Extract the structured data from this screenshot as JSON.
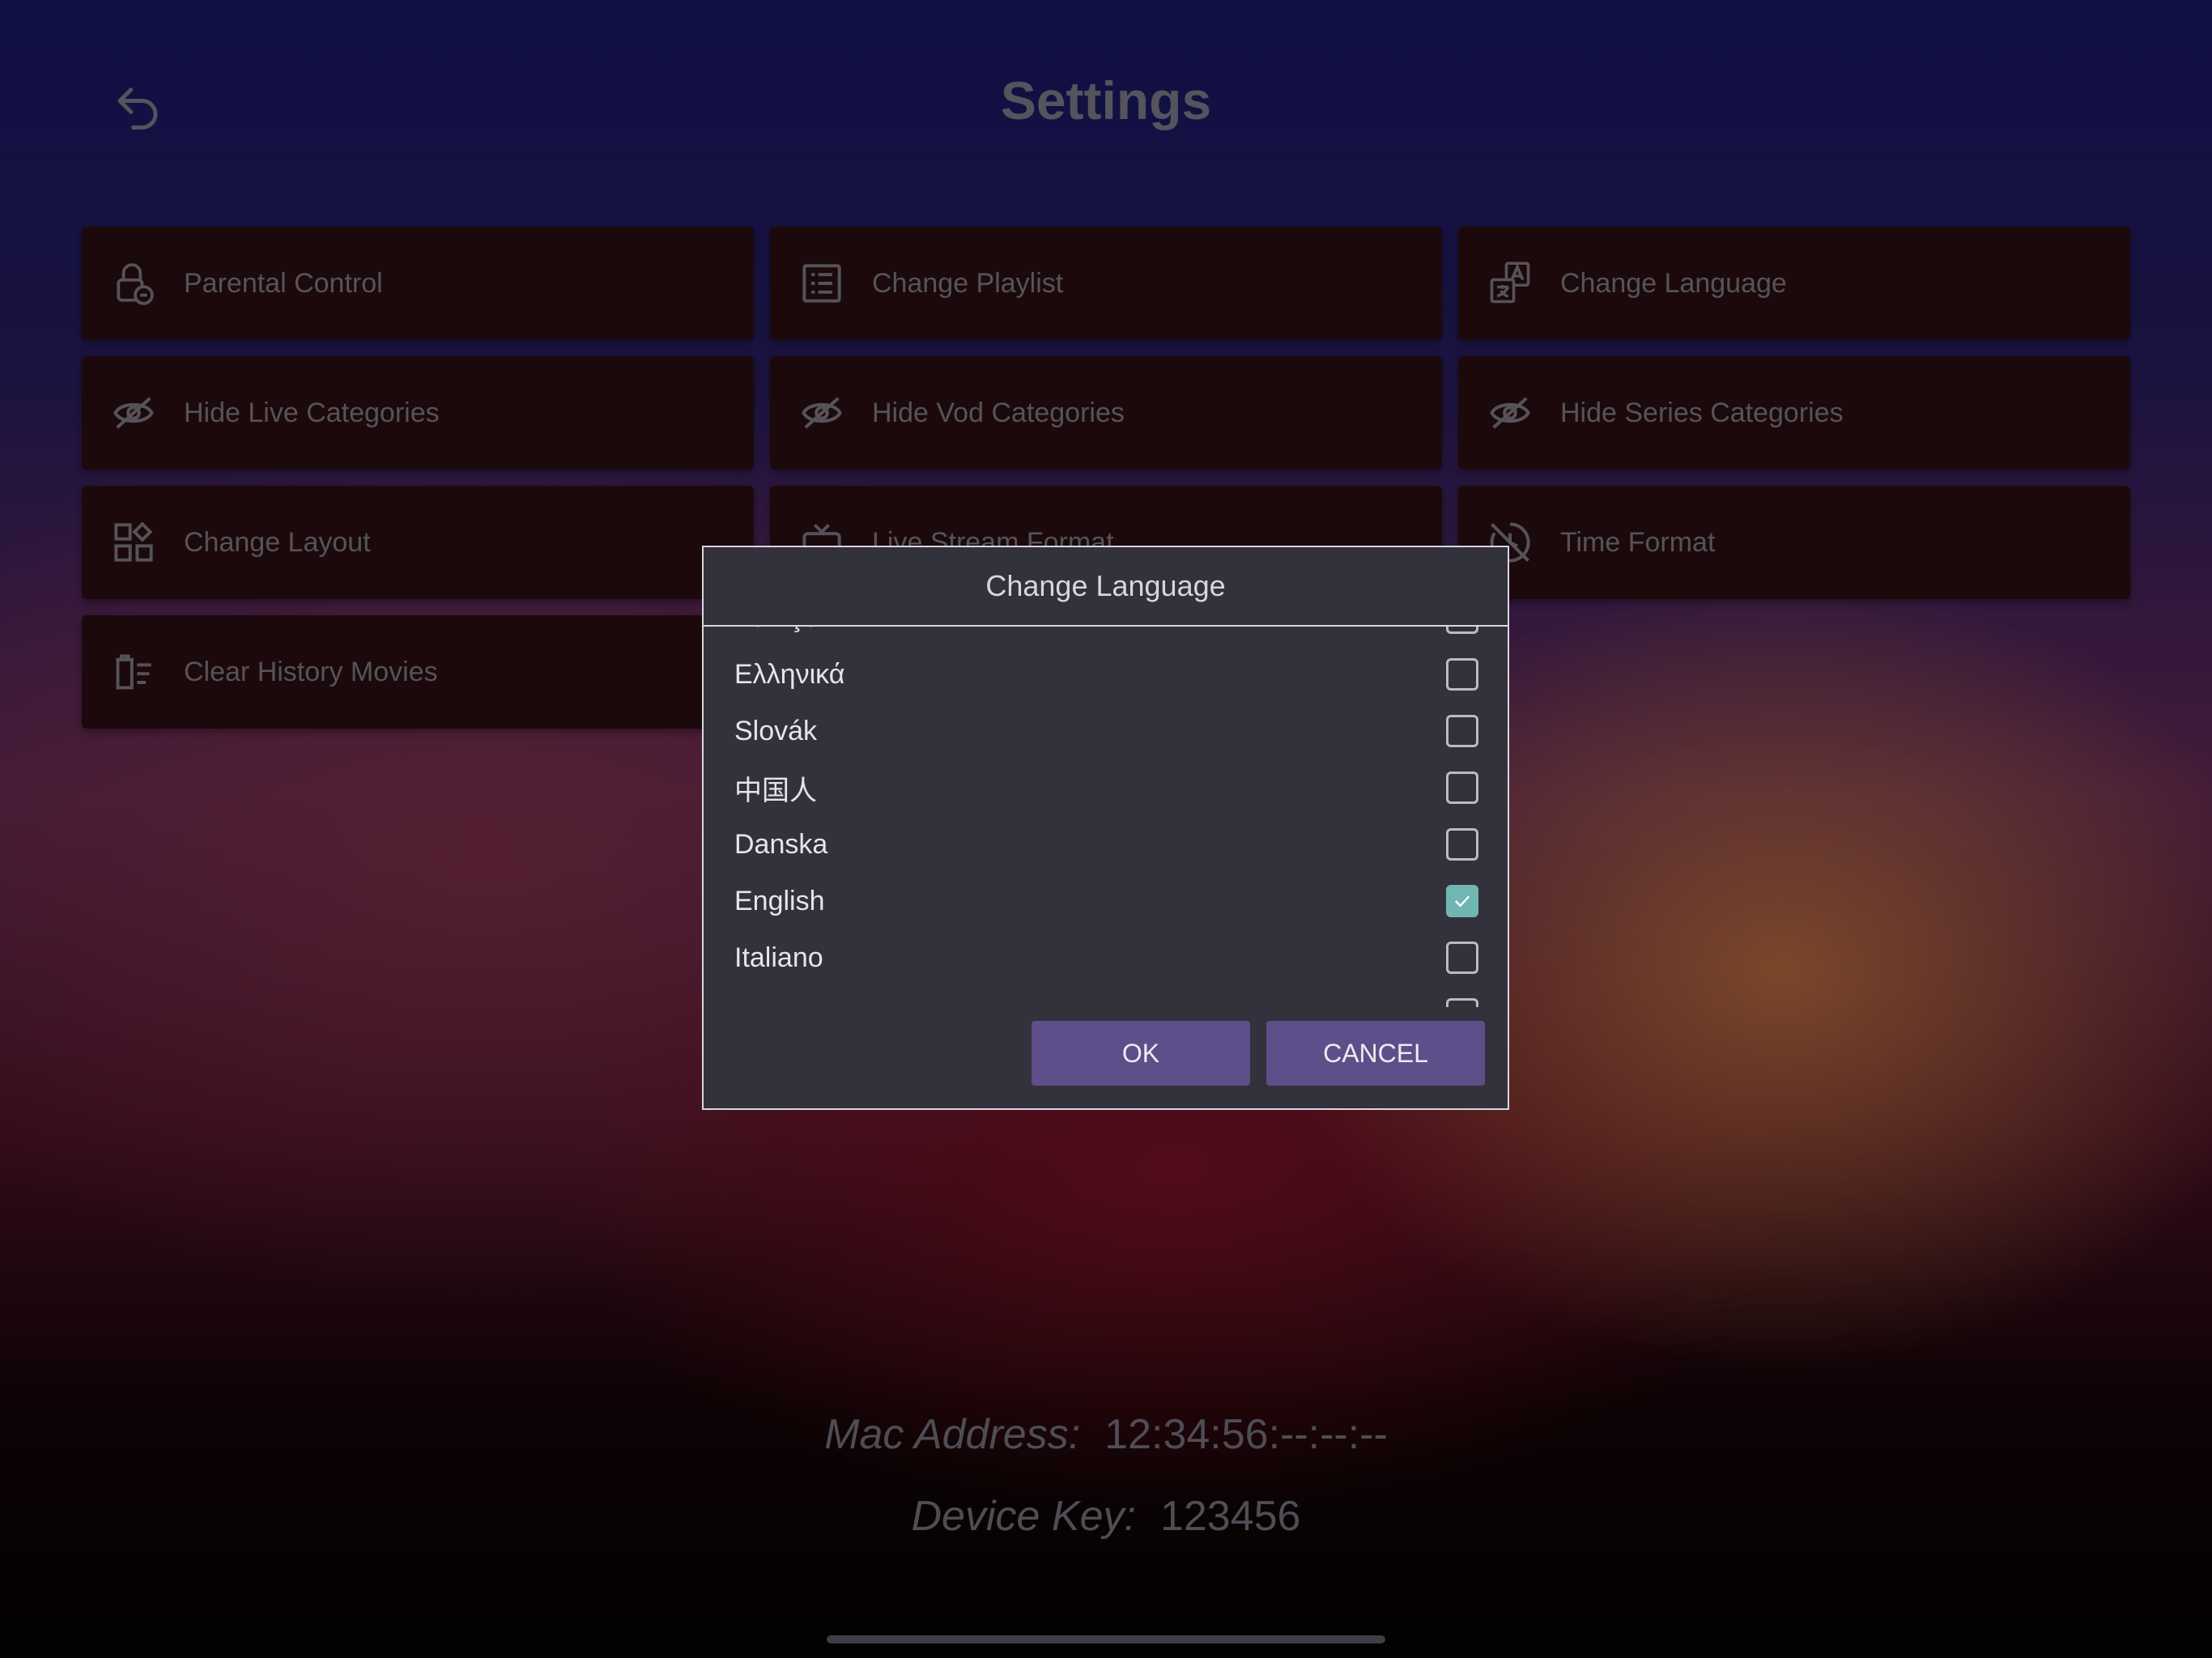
{
  "header": {
    "title": "Settings",
    "back_icon": "undo-arrow-icon"
  },
  "tiles": [
    {
      "label": "Parental Control",
      "icon": "lock-icon"
    },
    {
      "label": "Change Playlist",
      "icon": "playlist-icon"
    },
    {
      "label": "Change Language",
      "icon": "translate-icon"
    },
    {
      "label": "Hide Live Categories",
      "icon": "eye-off-icon"
    },
    {
      "label": "Hide Vod Categories",
      "icon": "eye-off-icon"
    },
    {
      "label": "Hide Series Categories",
      "icon": "eye-off-icon"
    },
    {
      "label": "Change Layout",
      "icon": "layout-icon"
    },
    {
      "label": "Live Stream Format",
      "icon": "tv-icon"
    },
    {
      "label": "Time Format",
      "icon": "clock-icon"
    },
    {
      "label": "Clear History Movies",
      "icon": "clear-history-icon"
    }
  ],
  "dialog": {
    "title": "Change Language",
    "languages": [
      {
        "name": "Türkçe",
        "checked": false
      },
      {
        "name": "Ελληνικά",
        "checked": false
      },
      {
        "name": "Slovák",
        "checked": false
      },
      {
        "name": "中国人",
        "checked": false
      },
      {
        "name": "Danska",
        "checked": false
      },
      {
        "name": "English",
        "checked": true
      },
      {
        "name": "Italiano",
        "checked": false
      },
      {
        "name": "",
        "checked": false
      }
    ],
    "ok_label": "OK",
    "cancel_label": "CANCEL"
  },
  "device": {
    "mac_label": "Mac Address:",
    "mac_value": "12:34:56:--:--:--",
    "key_label": "Device Key:",
    "key_value": "123456"
  },
  "colors": {
    "tile_bg": "#2e1013",
    "dialog_bg": "#33313c",
    "button_bg": "#5e4e8a",
    "checkbox_checked": "#6fb7b0"
  }
}
